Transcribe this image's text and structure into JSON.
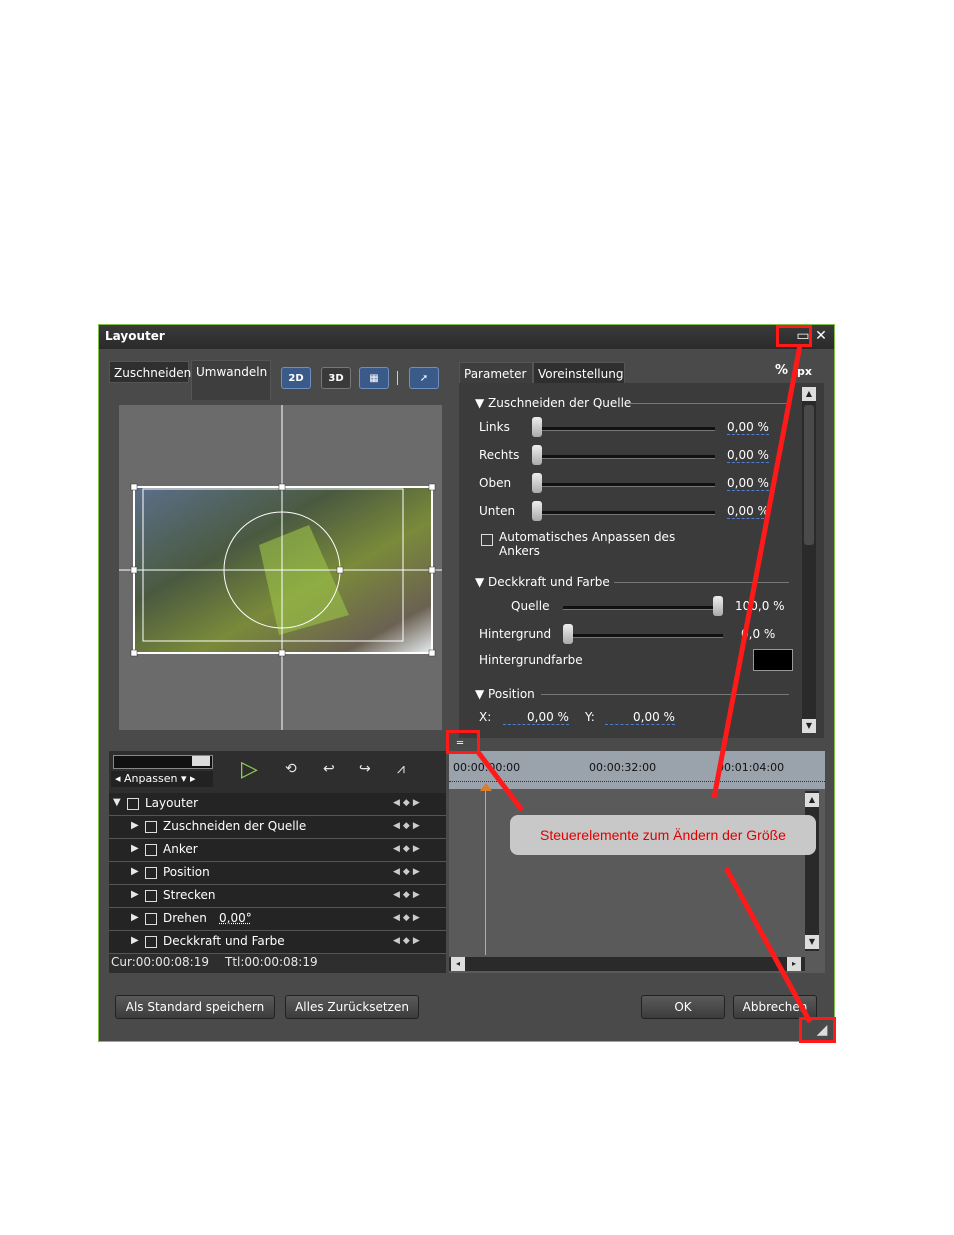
{
  "window": {
    "title": "Layouter"
  },
  "left_tabs": [
    "Zuschneiden",
    "Umwandeln"
  ],
  "toolbar_icons": [
    "2D",
    "3D"
  ],
  "right_tabs": [
    "Parameter",
    "Voreinstellung"
  ],
  "unit_toggle": {
    "percent": "%",
    "px": "px"
  },
  "sections": {
    "crop": {
      "title": "Zuschneiden der Quelle",
      "rows": [
        {
          "label": "Links",
          "value": "0,00 %"
        },
        {
          "label": "Rechts",
          "value": "0,00 %"
        },
        {
          "label": "Oben",
          "value": "0,00 %"
        },
        {
          "label": "Unten",
          "value": "0,00 %"
        }
      ],
      "auto_anchor": "Automatisches Anpassen des Ankers"
    },
    "opacity": {
      "title": "Deckkraft und Farbe",
      "source_label": "Quelle",
      "source_value": "100,0 %",
      "background_label": "Hintergrund",
      "background_value": "0,0 %",
      "bgcolor_label": "Hintergrundfarbe"
    },
    "position": {
      "title": "Position",
      "x_label": "X:",
      "x_value": "0,00 %",
      "y_label": "Y:",
      "y_value": "0,00 %"
    }
  },
  "timeline": {
    "fit_label": "Anpassen",
    "ruler": [
      "00:00:00:00",
      "00:00:32:00",
      "00:01:04:00"
    ],
    "tracks": [
      "Layouter",
      "Zuschneiden der Quelle",
      "Anker",
      "Position",
      "Strecken",
      "Drehen",
      "Deckkraft und Farbe"
    ],
    "rotate_value": "0,00°",
    "cur": "Cur:00:00:08:19",
    "ttl": "Ttl:00:00:08:19"
  },
  "buttons": {
    "save_default": "Als Standard speichern",
    "reset_all": "Alles Zurücksetzen",
    "ok": "OK",
    "cancel": "Abbrechen"
  },
  "annotation": "Steuerelemente zum Ändern der Größe",
  "colors": {
    "annotation_red": "#ff1a1a",
    "window_border": "#7fbf4a",
    "play_green": "#8fd14f"
  }
}
